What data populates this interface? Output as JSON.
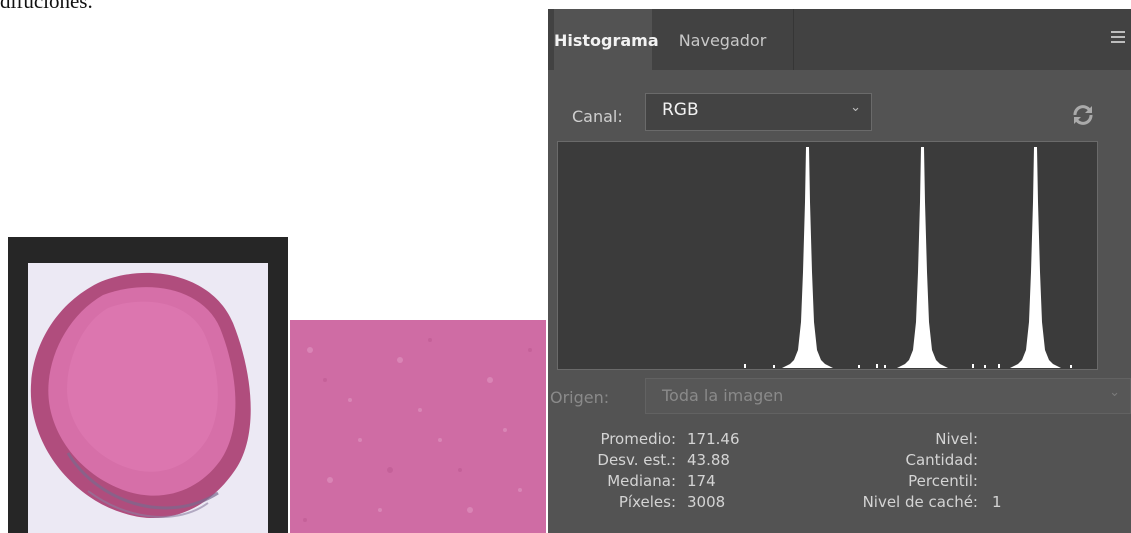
{
  "page": {
    "top_text": "difuciones."
  },
  "panel": {
    "tabs": [
      {
        "label": "Histograma"
      },
      {
        "label": "Navegador"
      }
    ],
    "menu_icon": "hamburger-menu-icon",
    "channel": {
      "label": "Canal:",
      "value": "RGB"
    },
    "refresh_icon": "refresh-icon",
    "source": {
      "label": "Origen:",
      "value": "Toda la imagen"
    },
    "stats": {
      "mean_label": "Promedio:",
      "mean": "171.46",
      "std_label": "Desv. est.:",
      "std": "43.88",
      "median_label": "Mediana:",
      "median": "174",
      "pixels_label": "Píxeles:",
      "pixels": "3008",
      "level_label": "Nivel:",
      "level": "",
      "count_label": "Cantidad:",
      "count": "",
      "percentile_label": "Percentil:",
      "percentile": "",
      "cache_label": "Nivel de caché:",
      "cache": "1"
    }
  },
  "colors": {
    "panel_bg": "#535353",
    "tab_bar_bg": "#424242",
    "histogram_fill": "#ffffff",
    "swatch_pink": "#cf6ca4",
    "frame_dark": "#262626"
  }
}
